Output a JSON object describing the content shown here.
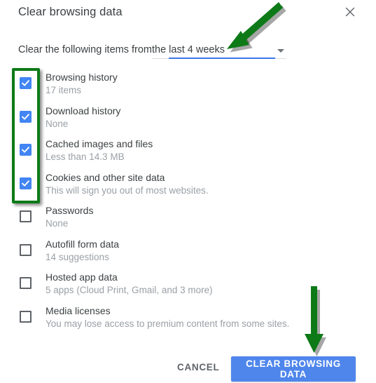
{
  "dialog": {
    "title": "Clear browsing data",
    "close_icon": "close-icon"
  },
  "range": {
    "label": "Clear the following items from",
    "value": "the last 4 weeks",
    "caret_icon": "chevron-down-icon"
  },
  "items": [
    {
      "title": "Browsing history",
      "sub": "17 items",
      "checked": true
    },
    {
      "title": "Download history",
      "sub": "None",
      "checked": true
    },
    {
      "title": "Cached images and files",
      "sub": "Less than 14.3 MB",
      "checked": true
    },
    {
      "title": "Cookies and other site data",
      "sub": "This will sign you out of most websites.",
      "checked": true
    },
    {
      "title": "Passwords",
      "sub": "None",
      "checked": false
    },
    {
      "title": "Autofill form data",
      "sub": "14 suggestions",
      "checked": false
    },
    {
      "title": "Hosted app data",
      "sub": "5 apps (Cloud Print, Gmail, and 3 more)",
      "checked": false
    },
    {
      "title": "Media licenses",
      "sub": "You may lose access to premium content from some sites.",
      "checked": false
    }
  ],
  "footer": {
    "cancel_label": "CANCEL",
    "clear_label": "CLEAR BROWSING DATA"
  },
  "annotations": {
    "green": "#0d7a17",
    "arrow_top_name": "annotation-arrow-time-range",
    "arrow_bottom_name": "annotation-arrow-clear-button",
    "box_name": "annotation-box-checked-items"
  },
  "colors": {
    "accent_blue": "#4285f4",
    "button_blue": "#4f86ec",
    "underline_blue": "#3b78e7",
    "annotation_green": "#0d7a17",
    "text_primary": "#3c4043",
    "text_secondary": "#9aa0a6"
  }
}
